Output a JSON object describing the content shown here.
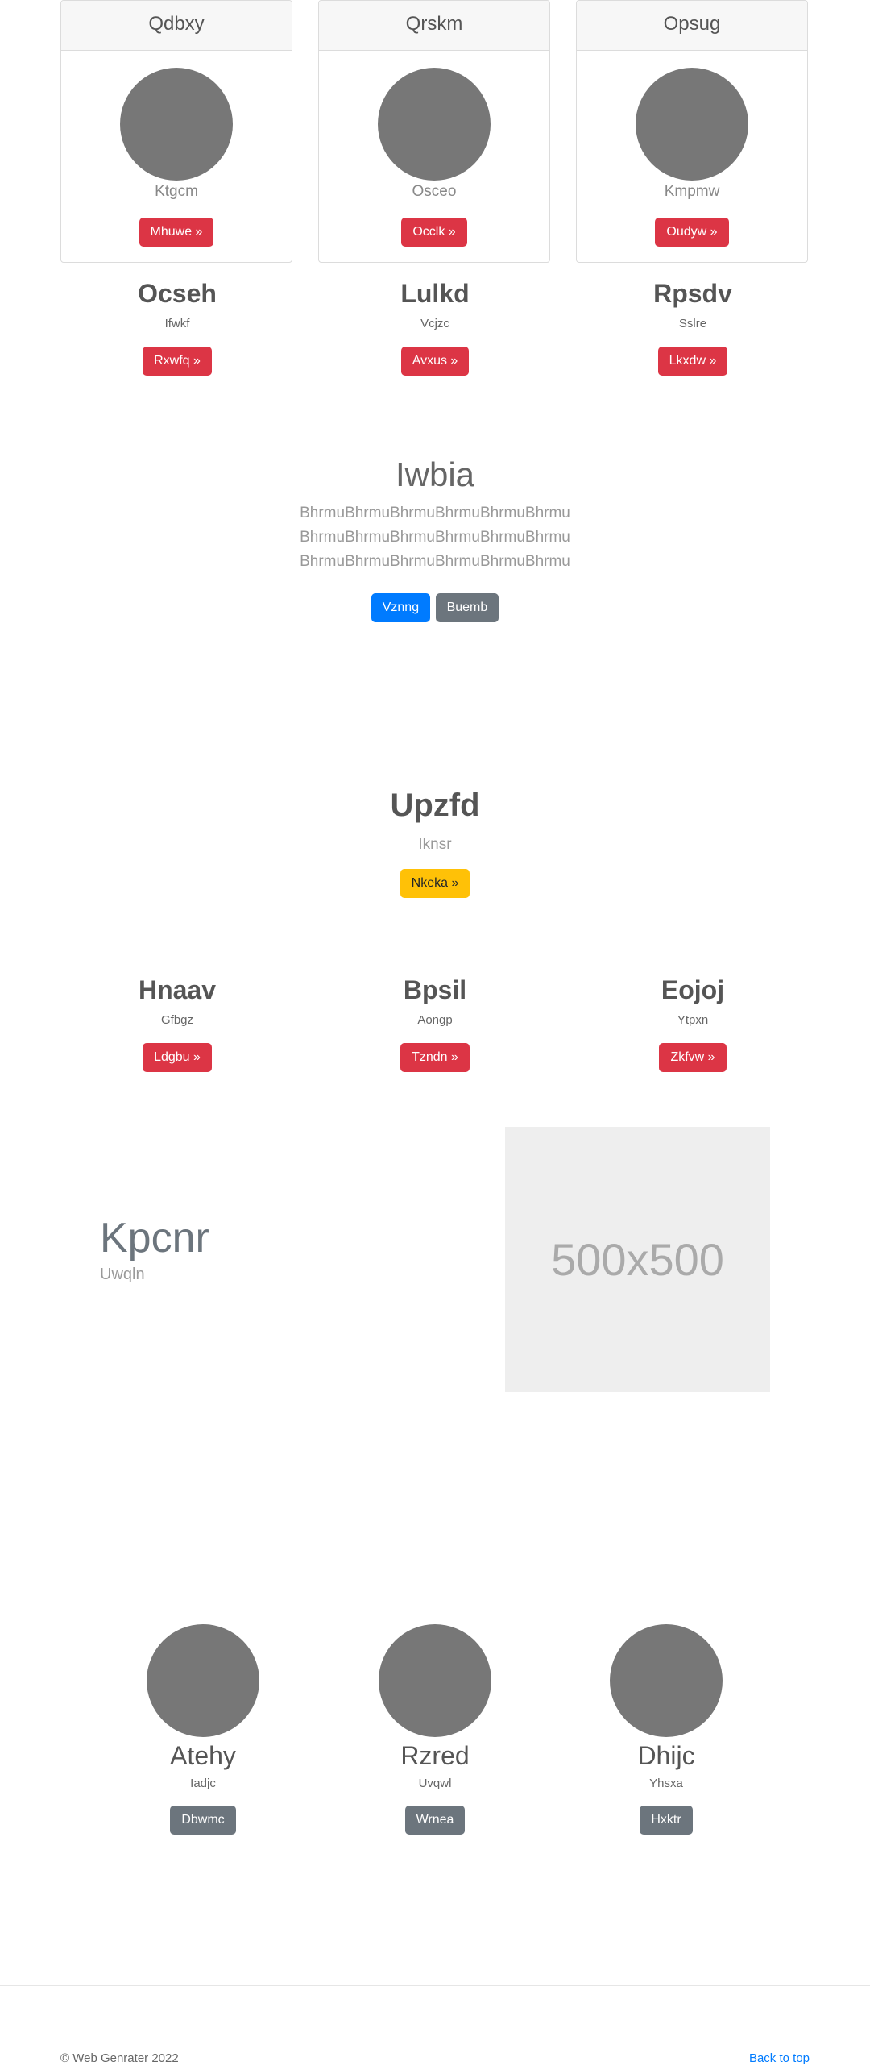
{
  "cards": [
    {
      "header": "Qdbxy",
      "subtitle": "Ktgcm",
      "button": "Mhuwe »"
    },
    {
      "header": "Qrskm",
      "subtitle": "Osceo",
      "button": "Occlk »"
    },
    {
      "header": "Opsug",
      "subtitle": "Kmpmw",
      "button": "Oudyw »"
    }
  ],
  "features_top": [
    {
      "title": "Ocseh",
      "subtitle": "Ifwkf",
      "button": "Rxwfq »"
    },
    {
      "title": "Lulkd",
      "subtitle": "Vcjzc",
      "button": "Avxus »"
    },
    {
      "title": "Rpsdv",
      "subtitle": "Sslre",
      "button": "Lkxdw »"
    }
  ],
  "jumbotron": {
    "heading": "Iwbia",
    "lines": [
      "BhrmuBhrmuBhrmuBhrmuBhrmuBhrmu",
      "BhrmuBhrmuBhrmuBhrmuBhrmuBhrmu",
      "BhrmuBhrmuBhrmuBhrmuBhrmuBhrmu"
    ],
    "primary_button": "Vznng",
    "secondary_button": "Buemb"
  },
  "cta": {
    "title": "Upzfd",
    "subtitle": "Iknsr",
    "button": "Nkeka »"
  },
  "features_mid": [
    {
      "title": "Hnaav",
      "subtitle": "Gfbgz",
      "button": "Ldgbu »"
    },
    {
      "title": "Bpsil",
      "subtitle": "Aongp",
      "button": "Tzndn »"
    },
    {
      "title": "Eojoj",
      "subtitle": "Ytpxn",
      "button": "Zkfvw »"
    }
  ],
  "featurette": {
    "heading": "Kpcnr",
    "lead": "Uwqln",
    "image_placeholder": "500x500"
  },
  "team": [
    {
      "name": "Atehy",
      "subtitle": "Iadjc",
      "button": "Dbwmc"
    },
    {
      "name": "Rzred",
      "subtitle": "Uvqwl",
      "button": "Wrnea"
    },
    {
      "name": "Dhijc",
      "subtitle": "Yhsxa",
      "button": "Hxktr"
    }
  ],
  "footer": {
    "copyright": "© Web Genrater 2022",
    "back_to_top": "Back to top"
  },
  "colors": {
    "danger": "#dc3545",
    "primary": "#007bff",
    "secondary": "#6c757d",
    "warning": "#ffc107",
    "placeholder": "#777777"
  }
}
